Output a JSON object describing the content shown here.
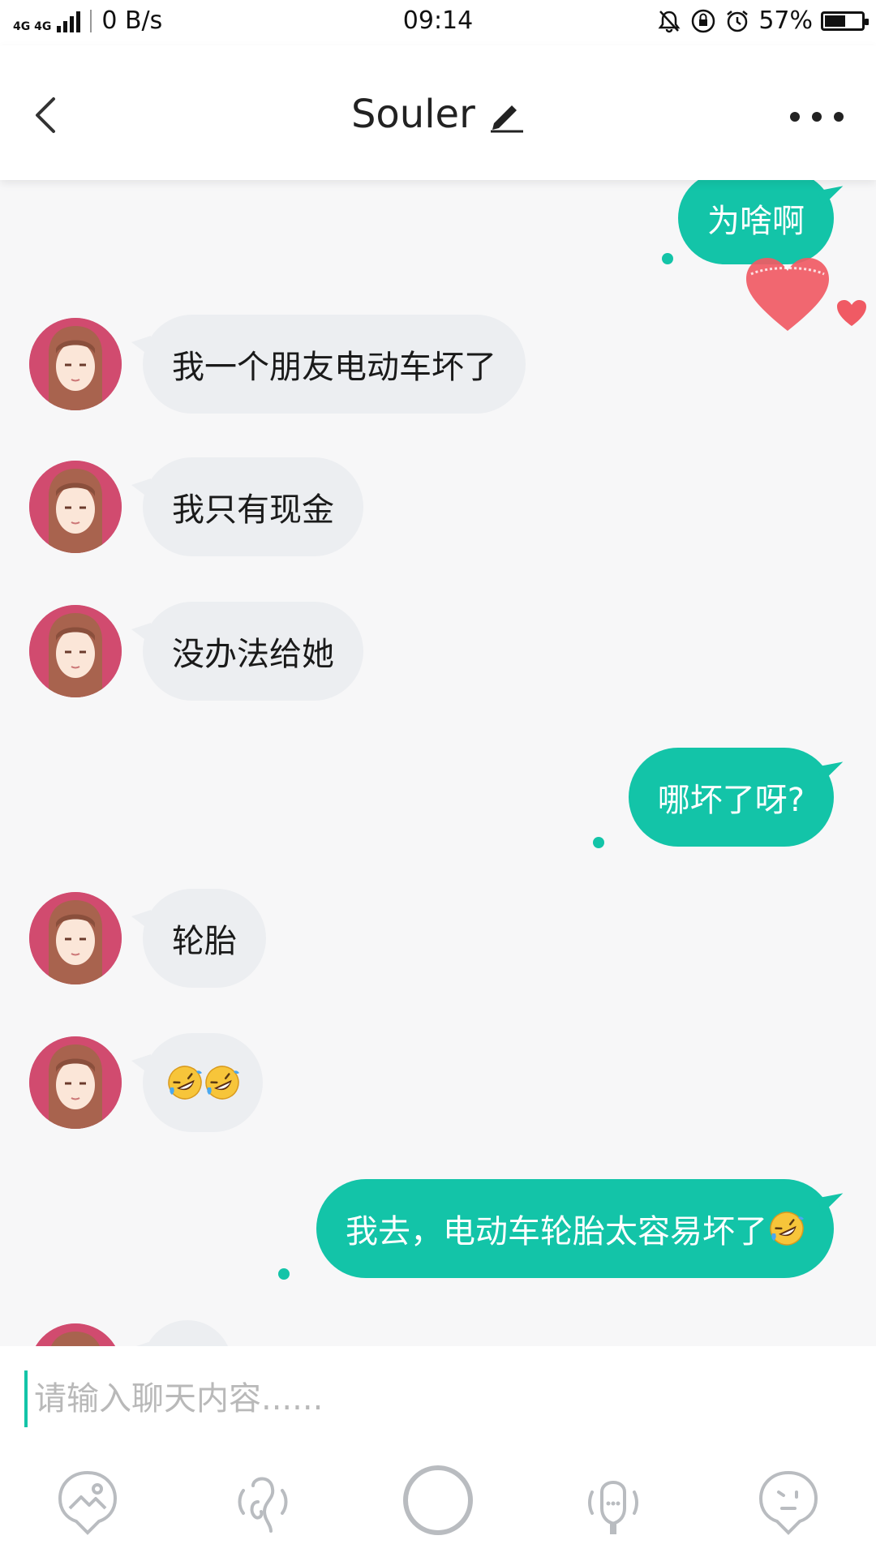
{
  "status_bar": {
    "network": "4G 4G",
    "speed": "0 B/s",
    "time": "09:14",
    "battery_percent": "57%",
    "battery_level": 0.57
  },
  "header": {
    "title": "Souler"
  },
  "messages": [
    {
      "side": "out",
      "text": "为啥啊"
    },
    {
      "side": "in",
      "text": "我一个朋友电动车坏了"
    },
    {
      "side": "in",
      "text": "我只有现金"
    },
    {
      "side": "in",
      "text": "没办法给她"
    },
    {
      "side": "out",
      "text": "哪坏了呀?"
    },
    {
      "side": "in",
      "text": "轮胎"
    },
    {
      "side": "in",
      "text": "",
      "emoji": "rolling-on-floor-laughing x2"
    },
    {
      "side": "out",
      "text": "我去，电动车轮胎太容易坏了",
      "emoji": "rolling-on-floor-laughing"
    }
  ],
  "input": {
    "placeholder": "请输入聊天内容......",
    "value": ""
  },
  "toolbar": {
    "items": [
      "image-icon",
      "voice-icon",
      "record-icon",
      "voice-change-icon",
      "emoji-icon"
    ]
  },
  "colors": {
    "accent": "#13c4a8",
    "incoming_bubble": "#eceef1",
    "heart": "#f05a64"
  }
}
